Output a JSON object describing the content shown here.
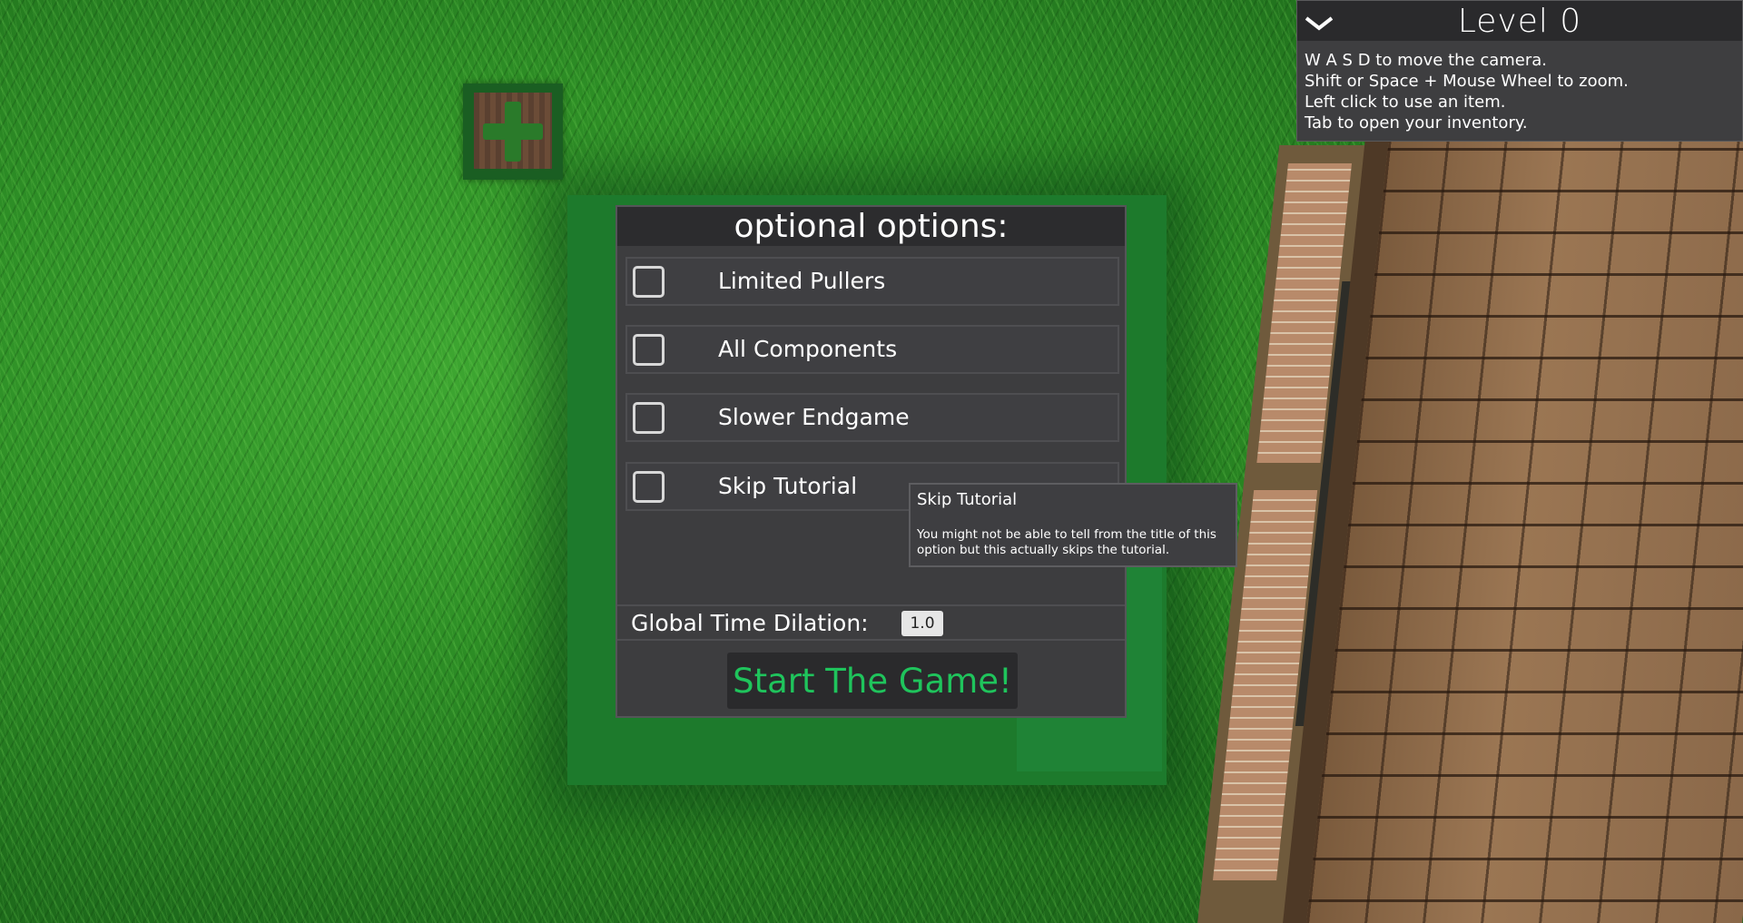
{
  "hud": {
    "level_title": "Level 0",
    "instructions": [
      "W A S D to move the camera.",
      "Shift or Space + Mouse Wheel to zoom.",
      "Left click to use an item.",
      "Tab to open your inventory."
    ]
  },
  "dialog": {
    "title": "optional options:",
    "options": [
      {
        "label": "Limited Pullers",
        "checked": false
      },
      {
        "label": "All Components",
        "checked": false
      },
      {
        "label": "Slower Endgame",
        "checked": false
      },
      {
        "label": "Skip Tutorial",
        "checked": false
      }
    ],
    "time_dilation_label": "Global Time Dilation:",
    "time_dilation_value": "1.0",
    "start_label": "Start The Game!"
  },
  "tooltip": {
    "title": "Skip Tutorial",
    "body": "You might not be able to tell from the title of this option but this actually skips the tutorial."
  },
  "colors": {
    "panel_bg": "#3d3d3f",
    "header_bg": "#2c2c2e",
    "start_text": "#1fc45c",
    "grass": "#2e8f26"
  },
  "icons": {
    "collapse": "chevron-down-icon",
    "crate": "plus-crate-icon"
  }
}
